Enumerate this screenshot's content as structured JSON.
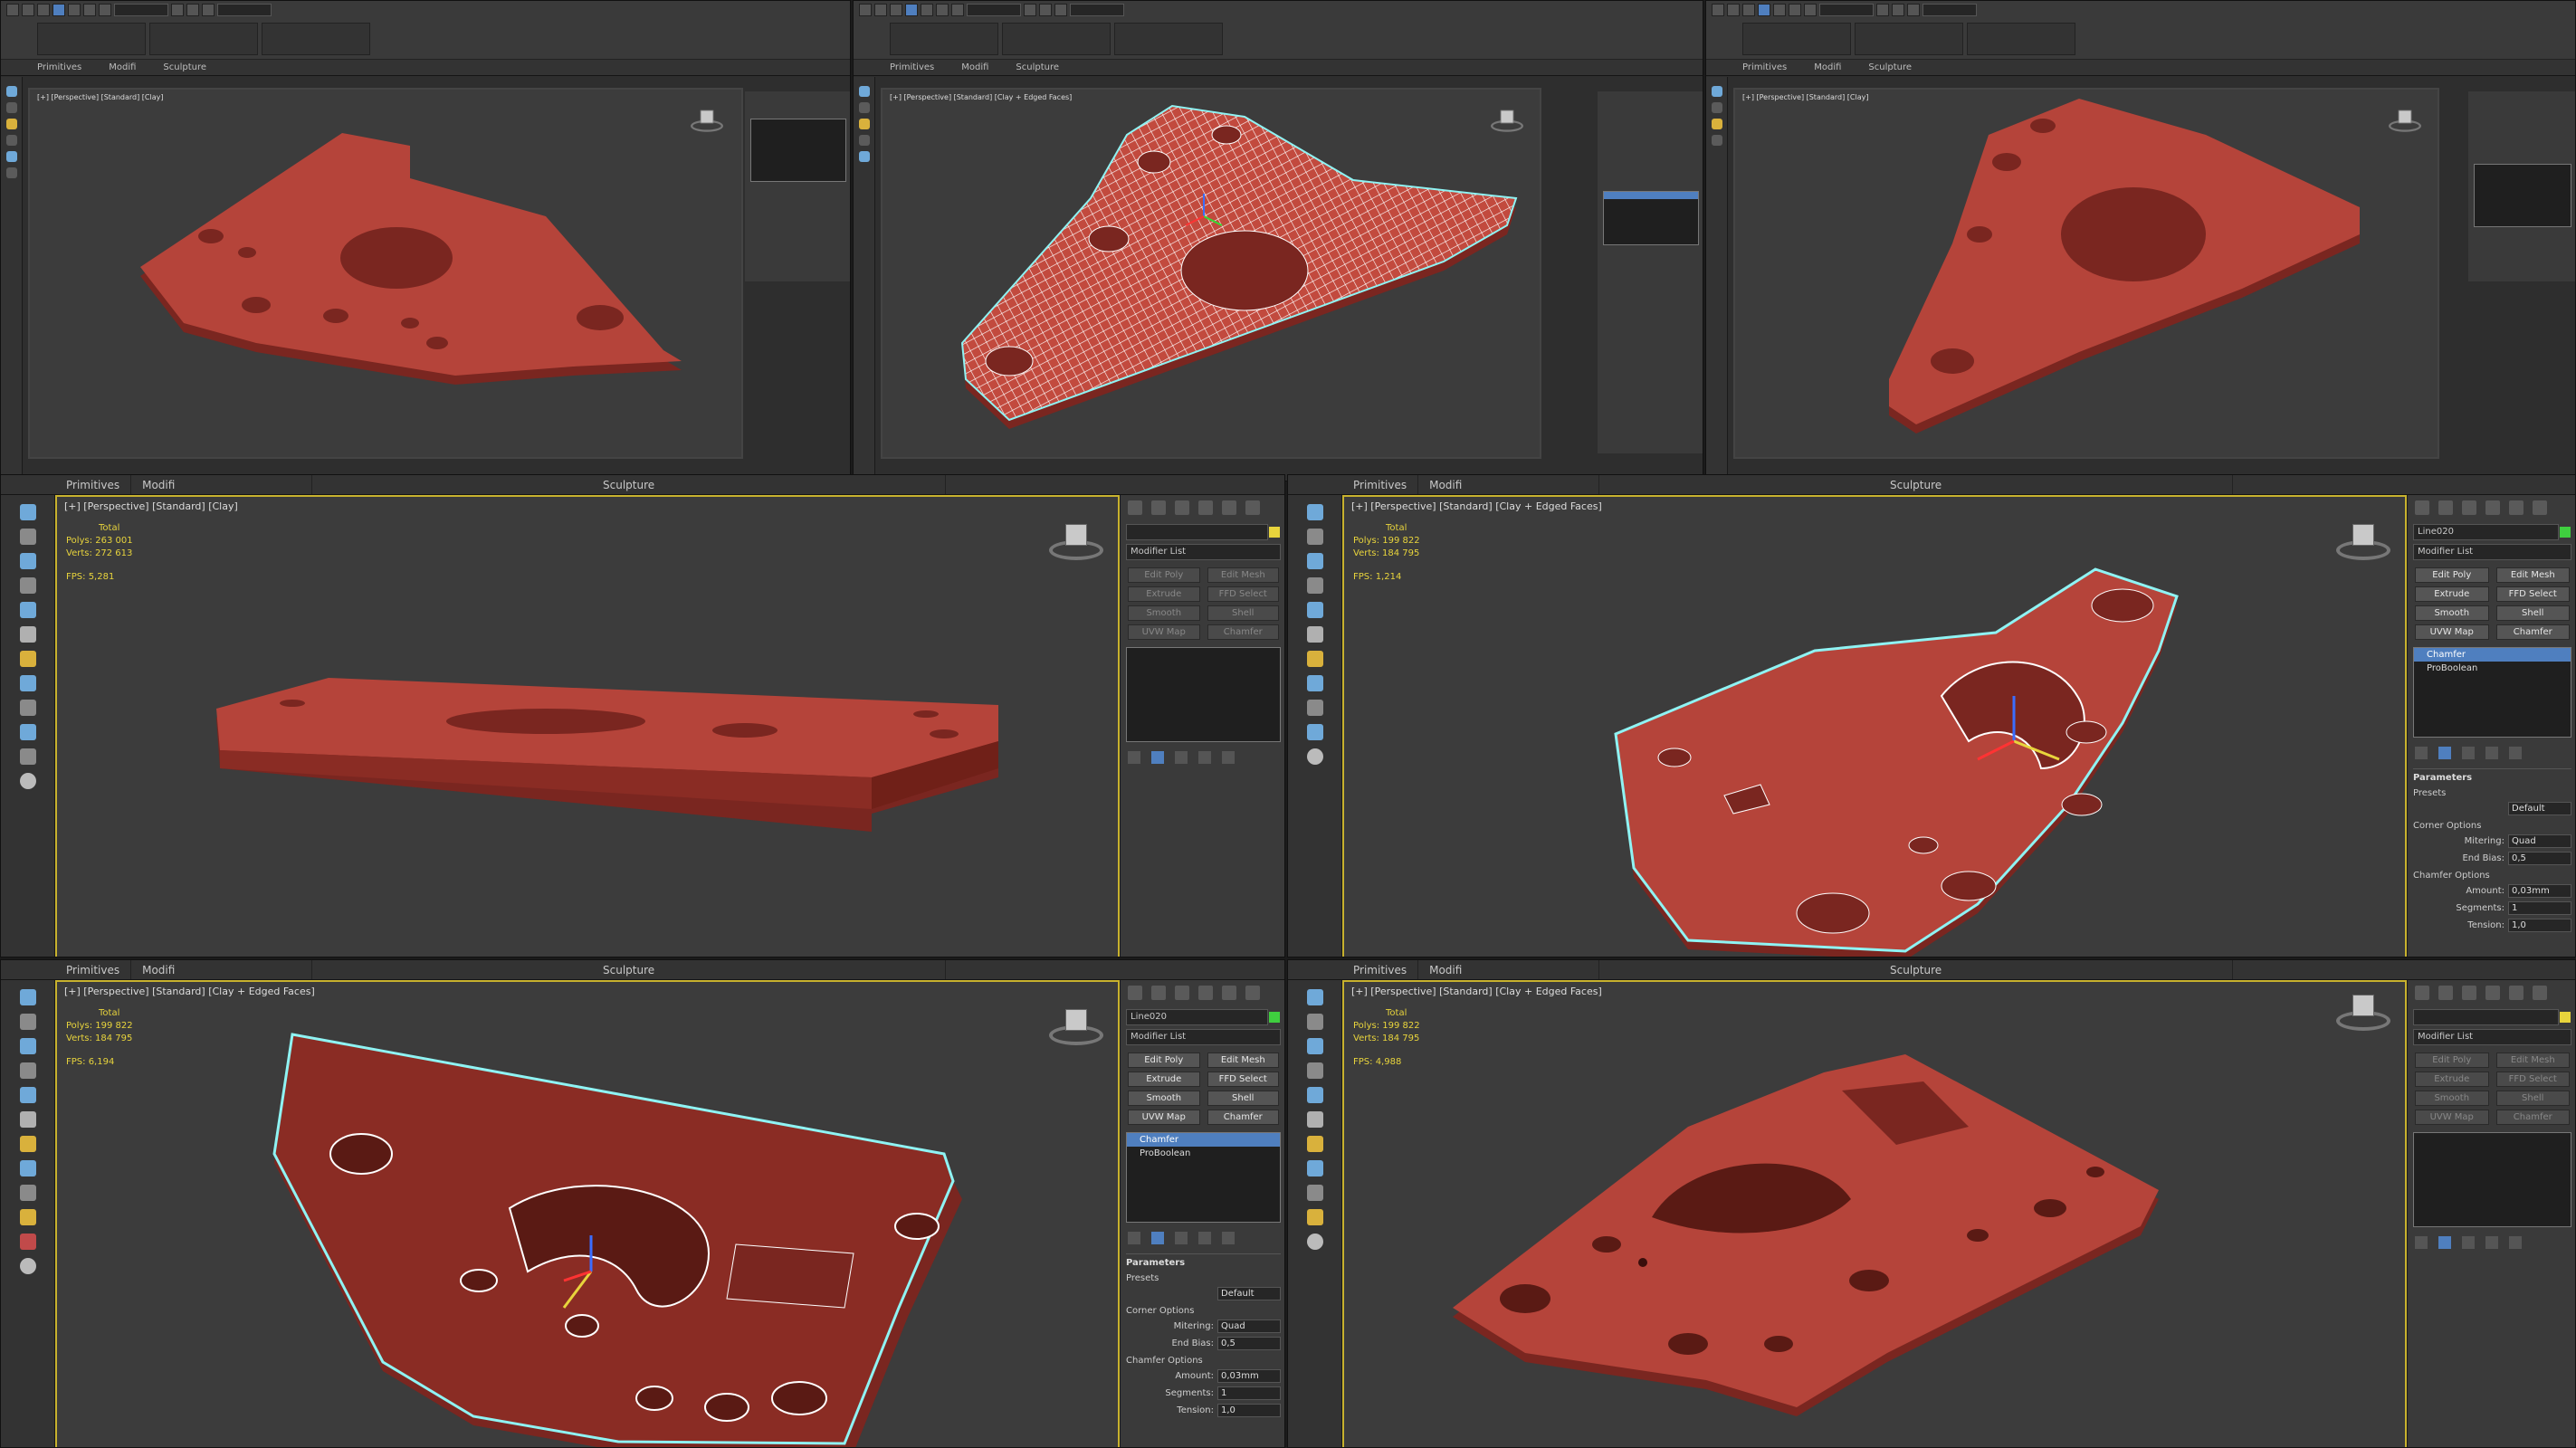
{
  "colors": {
    "model_fill": "#b5443a",
    "model_dark": "#8a2c24",
    "model_side": "#7a2620",
    "edge_cyan": "#8ff3f3",
    "wire": "#ffffff",
    "viewport_bg": "#3c3c3c",
    "active_border": "#c8b22e",
    "stats_text": "#e8d43c",
    "selection_blue": "#4f7fbf"
  },
  "top_panels": [
    {
      "tabs": [
        "Primitives",
        "Modifi",
        "Sculpture"
      ],
      "viewport_label": "[+] [Perspective] [Standard] [Clay]"
    },
    {
      "tabs": [
        "Primitives",
        "Modifi",
        "Sculpture"
      ],
      "viewport_label": "[+] [Perspective] [Standard] [Clay + Edged Faces]"
    },
    {
      "tabs": [
        "Primitives",
        "Modifi",
        "Sculpture"
      ],
      "viewport_label": "[+] [Perspective] [Standard] [Clay]"
    }
  ],
  "panels": [
    {
      "tabs": {
        "primitives": "Primitives",
        "modify": "Modifi",
        "sculpt": "Sculpture"
      },
      "viewport_label": "[+] [Perspective] [Standard] [Clay]",
      "stats": {
        "total": "Total",
        "polys_label": "Polys:",
        "polys": "263 001",
        "verts_label": "Verts:",
        "verts": "272 613",
        "fps_label": "FPS:",
        "fps": "5,281"
      },
      "modifier_list": "Modifier List",
      "object_name": "",
      "buttons": [
        "Edit Poly",
        "Edit Mesh",
        "Extrude",
        "FFD Select",
        "Smooth",
        "Shell",
        "UVW Map",
        "Chamfer"
      ],
      "stack": []
    },
    {
      "tabs": {
        "primitives": "Primitives",
        "modify": "Modifi",
        "sculpt": "Sculpture"
      },
      "viewport_label": "[+] [Perspective] [Standard] [Clay + Edged Faces]",
      "stats": {
        "total": "Total",
        "polys_label": "Polys:",
        "polys": "199 822",
        "verts_label": "Verts:",
        "verts": "184 795",
        "fps_label": "FPS:",
        "fps": "1,214"
      },
      "modifier_list": "Modifier List",
      "object_name": "Line020",
      "buttons": [
        "Edit Poly",
        "Edit Mesh",
        "Extrude",
        "FFD Select",
        "Smooth",
        "Shell",
        "UVW Map",
        "Chamfer"
      ],
      "stack": [
        "Chamfer",
        "ProBoolean"
      ],
      "params": {
        "title": "Parameters",
        "presets": "Presets",
        "preset_value": "Default",
        "corner_options": "Corner Options",
        "mitering_label": "Mitering:",
        "mitering": "Quad",
        "end_bias_label": "End Bias:",
        "end_bias": "0,5",
        "chamfer_options": "Chamfer Options",
        "amount_label": "Amount:",
        "amount": "0,03mm",
        "segments_label": "Segments:",
        "segments": "1",
        "tension_label": "Tension:",
        "tension": "1,0"
      }
    },
    {
      "tabs": {
        "primitives": "Primitives",
        "modify": "Modifi",
        "sculpt": "Sculpture"
      },
      "viewport_label": "[+] [Perspective] [Standard] [Clay + Edged Faces]",
      "stats": {
        "total": "Total",
        "polys_label": "Polys:",
        "polys": "199 822",
        "verts_label": "Verts:",
        "verts": "184 795",
        "fps_label": "FPS:",
        "fps": "6,194"
      },
      "modifier_list": "Modifier List",
      "object_name": "Line020",
      "buttons": [
        "Edit Poly",
        "Edit Mesh",
        "Extrude",
        "FFD Select",
        "Smooth",
        "Shell",
        "UVW Map",
        "Chamfer"
      ],
      "stack": [
        "Chamfer",
        "ProBoolean"
      ],
      "params": {
        "title": "Parameters",
        "presets": "Presets",
        "preset_value": "Default",
        "corner_options": "Corner Options",
        "mitering_label": "Mitering:",
        "mitering": "Quad",
        "end_bias_label": "End Bias:",
        "end_bias": "0,5",
        "chamfer_options": "Chamfer Options",
        "amount_label": "Amount:",
        "amount": "0,03mm",
        "segments_label": "Segments:",
        "segments": "1",
        "tension_label": "Tension:",
        "tension": "1,0"
      }
    },
    {
      "tabs": {
        "primitives": "Primitives",
        "modify": "Modifi",
        "sculpt": "Sculpture"
      },
      "viewport_label": "[+] [Perspective] [Standard] [Clay + Edged Faces]",
      "stats": {
        "total": "Total",
        "polys_label": "Polys:",
        "polys": "199 822",
        "verts_label": "Verts:",
        "verts": "184 795",
        "fps_label": "FPS:",
        "fps": "4,988"
      },
      "modifier_list": "Modifier List",
      "object_name": "",
      "buttons": [
        "Edit Poly",
        "Edit Mesh",
        "Extrude",
        "FFD Select",
        "Smooth",
        "Shell",
        "UVW Map",
        "Chamfer"
      ],
      "stack": []
    }
  ]
}
